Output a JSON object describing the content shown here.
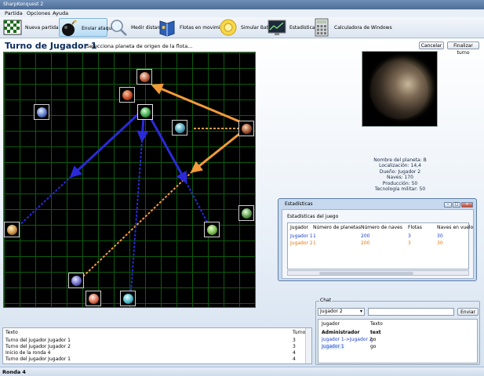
{
  "window": {
    "title": "SharpKonquest 2"
  },
  "menu": [
    "Partida",
    "Opciones",
    "Ayuda"
  ],
  "toolbar": [
    {
      "id": "new",
      "label": "Nueva partida",
      "icon": "grid-board-icon"
    },
    {
      "id": "attack",
      "label": "Enviar ataque",
      "icon": "bomb-icon"
    },
    {
      "id": "measure",
      "label": "Medir distancia",
      "icon": "magnifier-icon"
    },
    {
      "id": "fleets",
      "label": "Flotas en movimiento",
      "icon": "book-icon"
    },
    {
      "id": "simulate",
      "label": "Simular Batalla",
      "icon": "sun-gear-icon"
    },
    {
      "id": "stats",
      "label": "Estadísticas",
      "icon": "monitor-chart-icon"
    },
    {
      "id": "calc",
      "label": "Calculadora de Windows",
      "icon": "calculator-icon"
    }
  ],
  "turn": {
    "title": "Turno de Jugador 1",
    "hint": "Selecciona planeta de origen de la flota..."
  },
  "buttons": {
    "cancel": "Cancelar",
    "finish": "Finalizar turno"
  },
  "planet_info": {
    "name": "Nombre del planeta: B",
    "location": "Localización: 14,4",
    "owner": "Dueño: Jugador 2",
    "ships": "Naves: 170",
    "production": "Producción: 50",
    "tech": "Tecnología militar: 50"
  },
  "stats_window": {
    "title": "Estadísticas",
    "subtitle": "Estadísticas del juego",
    "columns": [
      "Jugador",
      "Número de planetas",
      "Número de naves",
      "Flotas",
      "Naves en vuelo"
    ],
    "rows": [
      {
        "player": "Jugador 1",
        "planets": "1",
        "ships": "200",
        "fleets": "3",
        "in_flight": "30",
        "color": "#1a3fc7"
      },
      {
        "player": "Jugador 2",
        "planets": "1",
        "ships": "200",
        "fleets": "3",
        "in_flight": "30",
        "color": "#e07a10"
      }
    ]
  },
  "log": {
    "columns": [
      "Texto",
      "Turno"
    ],
    "rows": [
      {
        "text": "Turno del jugador Jugador 1",
        "turn": "3"
      },
      {
        "text": "Turno del jugador Jugador 2",
        "turn": "3"
      },
      {
        "text": "Inicio de la ronda 4",
        "turn": "4"
      },
      {
        "text": "Turno del jugador Jugador 1",
        "turn": "4"
      }
    ]
  },
  "chat": {
    "legend": "Chat",
    "selected": "Jugador 2",
    "send_label": "Enviar",
    "input_value": "",
    "columns": [
      "Jugador",
      "Texto"
    ],
    "rows": [
      {
        "player": "Administrador",
        "text": "text",
        "bold": true,
        "color": "#000000"
      },
      {
        "player": "Jugador 1->Jugador 2",
        "text": "go",
        "bold": false,
        "color": "#1a3fc7"
      },
      {
        "player": "Jugador 1",
        "text": "go",
        "bold": false,
        "color": "#1a3fc7"
      }
    ]
  },
  "status": {
    "text": "Ronda 4"
  },
  "colors": {
    "player1": "#2a2ad8",
    "player2": "#f29a3a",
    "grid": "#0d5a0d"
  }
}
